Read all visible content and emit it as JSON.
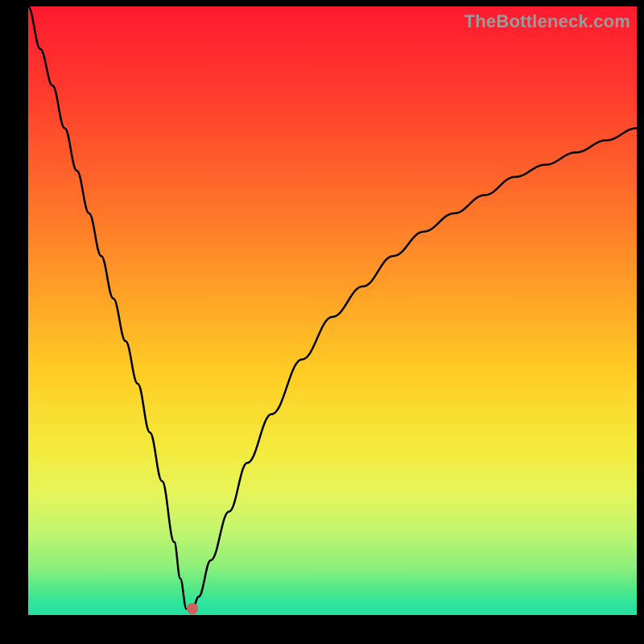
{
  "watermark": "TheBottleneck.com",
  "chart_data": {
    "type": "line",
    "title": "",
    "xlabel": "",
    "ylabel": "",
    "xlim": [
      0,
      100
    ],
    "ylim": [
      0,
      100
    ],
    "series": [
      {
        "name": "bottleneck-curve",
        "x": [
          0,
          2,
          4,
          6,
          8,
          10,
          12,
          14,
          16,
          18,
          20,
          22,
          24,
          25,
          26,
          27,
          28,
          30,
          33,
          36,
          40,
          45,
          50,
          55,
          60,
          65,
          70,
          75,
          80,
          85,
          90,
          95,
          100
        ],
        "values": [
          100,
          93,
          87,
          80,
          73,
          66,
          59,
          52,
          45,
          38,
          30,
          22,
          12,
          6,
          1,
          1,
          3,
          9,
          17,
          25,
          33,
          42,
          49,
          54,
          59,
          63,
          66,
          69,
          72,
          74,
          76,
          78,
          80
        ]
      }
    ],
    "marker": {
      "x": 27,
      "y": 1,
      "color": "#d0625e"
    },
    "gradient_colors": {
      "top": "#ff1a2f",
      "mid_upper": "#ff9a27",
      "mid_lower": "#f5e93a",
      "bottom": "#23e0a3"
    }
  }
}
